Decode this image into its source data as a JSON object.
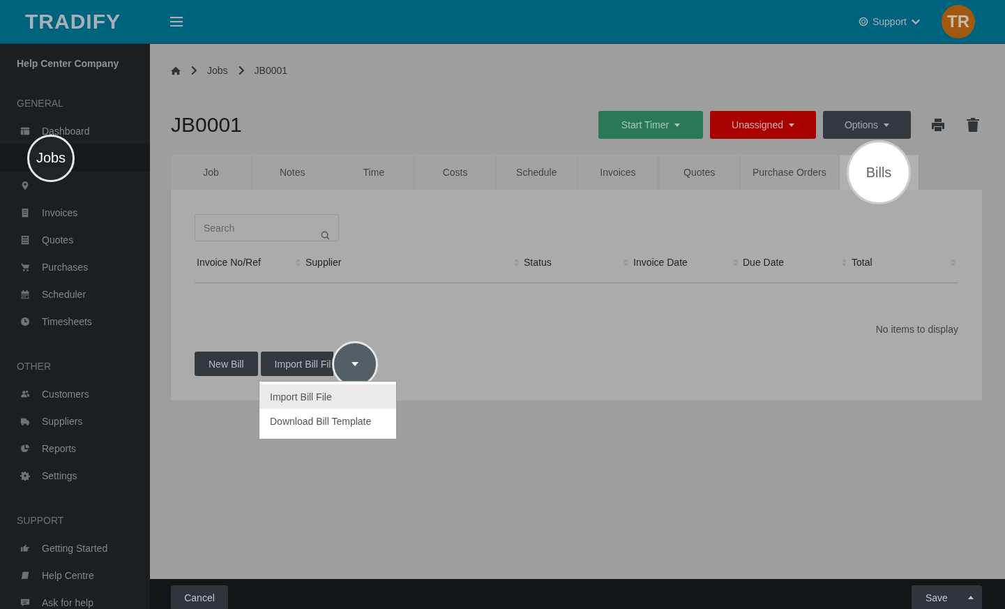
{
  "header": {
    "logo": "TRADIFY",
    "support": "Support",
    "avatar": "TR"
  },
  "sidebar": {
    "company": "Help Center Company",
    "sections": [
      {
        "title": "GENERAL",
        "items": [
          {
            "label": "Dashboard",
            "selected": false
          },
          {
            "label": "Jobs",
            "selected": true
          },
          {
            "selected": false
          },
          {
            "label": "Invoices",
            "selected": false
          },
          {
            "label": "Quotes",
            "selected": false
          },
          {
            "label": "Purchases",
            "selected": false
          },
          {
            "label": "Scheduler",
            "selected": false
          },
          {
            "label": "Timesheets",
            "selected": false
          }
        ]
      },
      {
        "title": "OTHER",
        "items": [
          {
            "label": "Customers",
            "selected": false
          },
          {
            "label": "Suppliers",
            "selected": false
          },
          {
            "label": "Reports",
            "selected": false
          },
          {
            "label": "Settings",
            "selected": false
          }
        ]
      },
      {
        "title": "SUPPORT",
        "items": [
          {
            "label": "Getting Started",
            "selected": false
          },
          {
            "label": "Help Centre",
            "selected": false
          },
          {
            "label": "Ask for help",
            "selected": false
          }
        ]
      }
    ]
  },
  "breadcrumb": [
    "Jobs",
    "JB0001"
  ],
  "title": "JB0001",
  "actions": [
    {
      "label": "Start Timer",
      "kind": "success"
    },
    {
      "label": "Unassigned",
      "kind": "danger"
    },
    {
      "label": "Options",
      "kind": "dark"
    }
  ],
  "tabs": [
    {
      "label": "Job",
      "selected": false
    },
    {
      "label": "Notes",
      "selected": false
    },
    {
      "label": "Time",
      "selected": false
    },
    {
      "label": "Costs",
      "selected": false
    },
    {
      "label": "Schedule",
      "selected": false
    },
    {
      "label": "Invoices",
      "selected": false
    },
    {
      "label": "Quotes",
      "selected": false
    },
    {
      "label": "Purchase Orders",
      "selected": false
    },
    {
      "label": "Bills",
      "selected": true
    }
  ],
  "search": {
    "placeholder": "Search"
  },
  "table": {
    "columns": [
      "Invoice No/Ref",
      "Supplier",
      "Status",
      "Invoice Date",
      "Due Date",
      "Total"
    ],
    "empty": "No items to display"
  },
  "buttons": {
    "new": "New Bill",
    "import": "Import Bill Fil"
  },
  "menu": [
    {
      "label": "Import Bill File",
      "selected": true
    },
    {
      "label": "Download Bill Template",
      "selected": false
    }
  ],
  "footer": {
    "cancel": "Cancel",
    "save": "Save"
  }
}
